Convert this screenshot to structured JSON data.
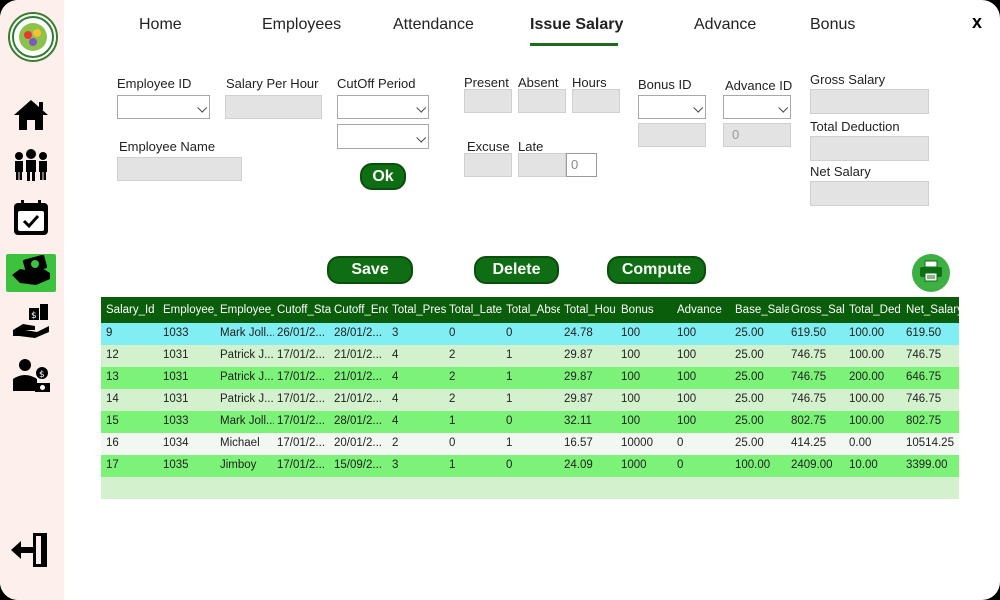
{
  "nav": {
    "tabs": [
      {
        "label": "Home"
      },
      {
        "label": "Employees"
      },
      {
        "label": "Attendance"
      },
      {
        "label": "Issue Salary"
      },
      {
        "label": "Advance"
      },
      {
        "label": "Bonus"
      }
    ],
    "active": "Issue Salary",
    "close_label": "x"
  },
  "sidebar": {
    "items": [
      "home-icon",
      "employees-icon",
      "attendance-calendar-icon",
      "salary-money-icon",
      "advance-icon",
      "bonus-icon"
    ],
    "active": "salary-money-icon",
    "logout": "logout-icon"
  },
  "form": {
    "employee_id_label": "Employee ID",
    "salary_per_hour_label": "Salary Per Hour",
    "cutoff_period_label": "CutOff Period",
    "employee_name_label": "Employee Name",
    "ok_label": "Ok",
    "present_label": "Present",
    "absent_label": "Absent",
    "hours_label": "Hours",
    "excuse_label": "Excuse",
    "late_label": "Late",
    "late_value": "0",
    "bonus_id_label": "Bonus ID",
    "advance_id_label": "Advance ID",
    "advance_value": "0",
    "gross_salary_label": "Gross Salary",
    "total_deduction_label": "Total Deduction",
    "net_salary_label": "Net Salary"
  },
  "actions": {
    "save_label": "Save",
    "delete_label": "Delete",
    "compute_label": "Compute",
    "print_icon": "printer-icon"
  },
  "table": {
    "columns": [
      "Salary_Id",
      "Employee_",
      "Employee_",
      "Cutoff_Sta",
      "Cutoff_Enc",
      "Total_Pres",
      "Total_Late",
      "Total_Abse",
      "Total_Hou",
      "Bonus",
      "Advance",
      "Base_Sala",
      "Gross_Sala",
      "Total_Ded",
      "Net_Salary"
    ],
    "rows": [
      [
        "9",
        "1033",
        "Mark Joll...",
        "26/01/2...",
        "28/01/2...",
        "3",
        "0",
        "0",
        "24.78",
        "100",
        "100",
        "25.00",
        "619.50",
        "100.00",
        "619.50"
      ],
      [
        "12",
        "1031",
        "Patrick J...",
        "17/01/2...",
        "21/01/2...",
        "4",
        "2",
        "1",
        "29.87",
        "100",
        "100",
        "25.00",
        "746.75",
        "100.00",
        "746.75"
      ],
      [
        "13",
        "1031",
        "Patrick J...",
        "17/01/2...",
        "21/01/2...",
        "4",
        "2",
        "1",
        "29.87",
        "100",
        "100",
        "25.00",
        "746.75",
        "200.00",
        "646.75"
      ],
      [
        "14",
        "1031",
        "Patrick J...",
        "17/01/2...",
        "21/01/2...",
        "4",
        "2",
        "1",
        "29.87",
        "100",
        "100",
        "25.00",
        "746.75",
        "100.00",
        "746.75"
      ],
      [
        "15",
        "1033",
        "Mark Joll...",
        "17/01/2...",
        "28/01/2...",
        "4",
        "1",
        "0",
        "32.11",
        "100",
        "100",
        "25.00",
        "802.75",
        "100.00",
        "802.75"
      ],
      [
        "16",
        "1034",
        "Michael",
        "17/01/2...",
        "20/01/2...",
        "2",
        "0",
        "1",
        "16.57",
        "10000",
        "0",
        "25.00",
        "414.25",
        "0.00",
        "10514.25"
      ],
      [
        "17",
        "1035",
        "Jimboy",
        "17/01/2...",
        "15/09/2...",
        "3",
        "1",
        "0",
        "24.09",
        "1000",
        "0",
        "100.00",
        "2409.00",
        "10.00",
        "3399.00"
      ]
    ],
    "selected_row": 0,
    "colors": {
      "header": "#0a5d0a",
      "selected": "#80eef2",
      "row_light": "#d3f1cc",
      "row_bright": "#7cf278",
      "row_white": "#f2f7f2",
      "empty": "#c9f0c3"
    }
  }
}
